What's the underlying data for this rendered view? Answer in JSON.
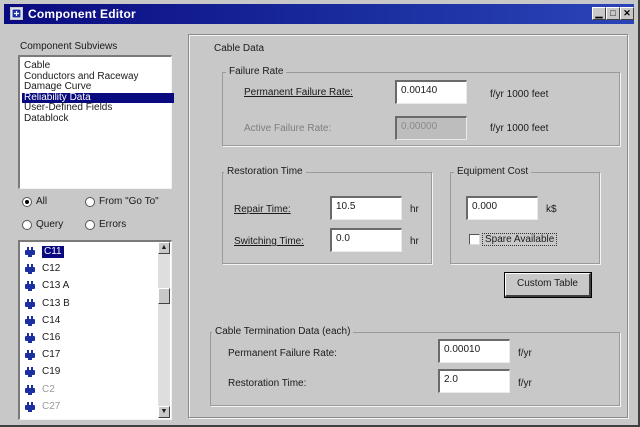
{
  "window": {
    "title": "Component Editor"
  },
  "subviews": {
    "label": "Component Subviews",
    "items": [
      "Cable",
      "Conductors and Raceway",
      "Damage Curve",
      "Reliability Data",
      "User-Defined Fields",
      "Datablock"
    ],
    "selected_index": 3
  },
  "filters": {
    "all": "All",
    "from_go_to": "From \"Go To\"",
    "query": "Query",
    "errors": "Errors",
    "selected": "all"
  },
  "components": {
    "items": [
      "C11",
      "C12",
      "C13 A",
      "C13 B",
      "C14",
      "C16",
      "C17",
      "C19",
      "C2",
      "C27"
    ],
    "selected_index": 0,
    "dimmed_from_index": 8
  },
  "cable_data": {
    "title": "Cable Data",
    "failure_rate": {
      "title": "Failure Rate",
      "permanent_label": "Permanent Failure Rate:",
      "permanent_value": "0.00140",
      "permanent_unit": "f/yr 1000 feet",
      "active_label": "Active Failure Rate:",
      "active_value": "0.00000",
      "active_unit": "f/yr 1000 feet"
    },
    "restoration_time": {
      "title": "Restoration Time",
      "repair_label": "Repair Time:",
      "repair_value": "10.5",
      "repair_unit": "hr",
      "switching_label": "Switching Time:",
      "switching_value": "0.0",
      "switching_unit": "hr"
    },
    "equipment_cost": {
      "title": "Equipment Cost",
      "value": "0.000",
      "unit": "k$",
      "spare_label": "Spare Available"
    },
    "custom_table_button": "Custom Table"
  },
  "termination_data": {
    "title": "Cable Termination Data (each)",
    "failure_label": "Permanent Failure Rate:",
    "failure_value": "0.00010",
    "failure_unit": "f/yr",
    "restoration_label": "Restoration Time:",
    "restoration_value": "2.0",
    "restoration_unit": "f/yr"
  },
  "colors": {
    "title_bar": "#0a0a80",
    "selection": "#0a0a80",
    "face": "#c8c8c8"
  }
}
